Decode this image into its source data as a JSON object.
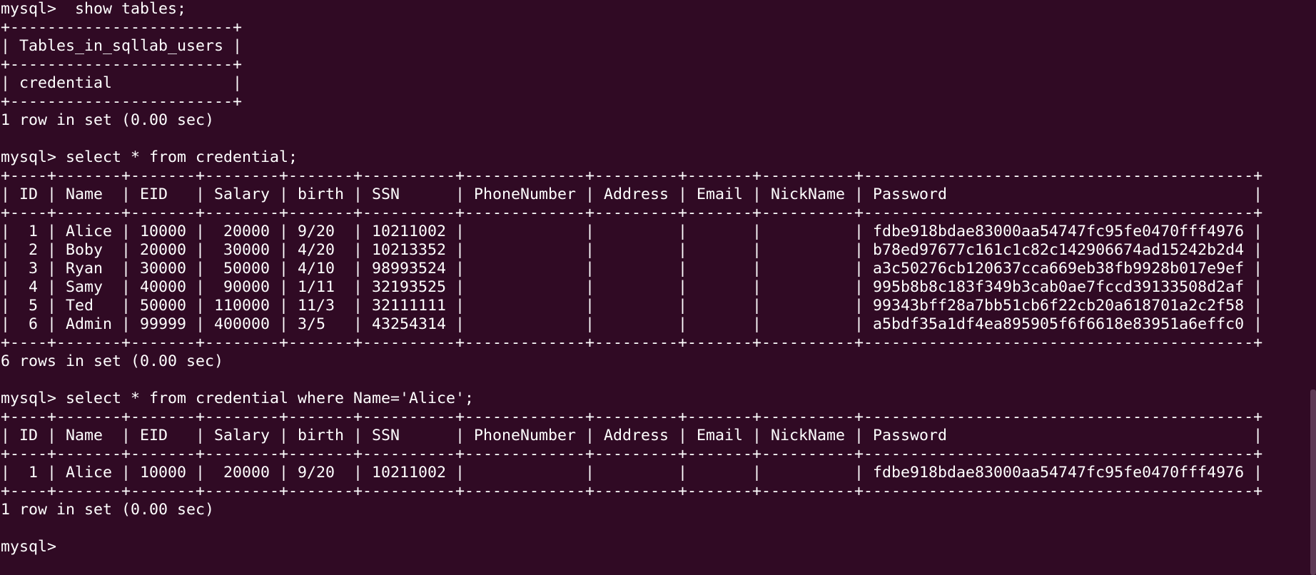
{
  "terminal": {
    "lines": [
      "mysql>  show tables;",
      "+------------------------+",
      "| Tables_in_sqllab_users |",
      "+------------------------+",
      "| credential             |",
      "+------------------------+",
      "1 row in set (0.00 sec)",
      "",
      "mysql> select * from credential;",
      "+----+-------+-------+--------+-------+----------+-------------+---------+-------+----------+------------------------------------------+",
      "| ID | Name  | EID   | Salary | birth | SSN      | PhoneNumber | Address | Email | NickName | Password                                 |",
      "+----+-------+-------+--------+-------+----------+-------------+---------+-------+----------+------------------------------------------+",
      "|  1 | Alice | 10000 |  20000 | 9/20  | 10211002 |             |         |       |          | fdbe918bdae83000aa54747fc95fe0470fff4976 |",
      "|  2 | Boby  | 20000 |  30000 | 4/20  | 10213352 |             |         |       |          | b78ed97677c161c1c82c142906674ad15242b2d4 |",
      "|  3 | Ryan  | 30000 |  50000 | 4/10  | 98993524 |             |         |       |          | a3c50276cb120637cca669eb38fb9928b017e9ef |",
      "|  4 | Samy  | 40000 |  90000 | 1/11  | 32193525 |             |         |       |          | 995b8b8c183f349b3cab0ae7fccd39133508d2af |",
      "|  5 | Ted   | 50000 | 110000 | 11/3  | 32111111 |             |         |       |          | 99343bff28a7bb51cb6f22cb20a618701a2c2f58 |",
      "|  6 | Admin | 99999 | 400000 | 3/5   | 43254314 |             |         |       |          | a5bdf35a1df4ea895905f6f6618e83951a6effc0 |",
      "+----+-------+-------+--------+-------+----------+-------------+---------+-------+----------+------------------------------------------+",
      "6 rows in set (0.00 sec)",
      "",
      "mysql> select * from credential where Name='Alice';",
      "+----+-------+-------+--------+-------+----------+-------------+---------+-------+----------+------------------------------------------+",
      "| ID | Name  | EID   | Salary | birth | SSN      | PhoneNumber | Address | Email | NickName | Password                                 |",
      "+----+-------+-------+--------+-------+----------+-------------+---------+-------+----------+------------------------------------------+",
      "|  1 | Alice | 10000 |  20000 | 9/20  | 10211002 |             |         |       |          | fdbe918bdae83000aa54747fc95fe0470fff4976 |",
      "+----+-------+-------+--------+-------+----------+-------------+---------+-------+----------+------------------------------------------+",
      "1 row in set (0.00 sec)",
      "",
      "mysql> "
    ]
  },
  "colors": {
    "background": "#300a24",
    "foreground": "#ffffff",
    "scrollbar_thumb": "#5e3a55"
  }
}
